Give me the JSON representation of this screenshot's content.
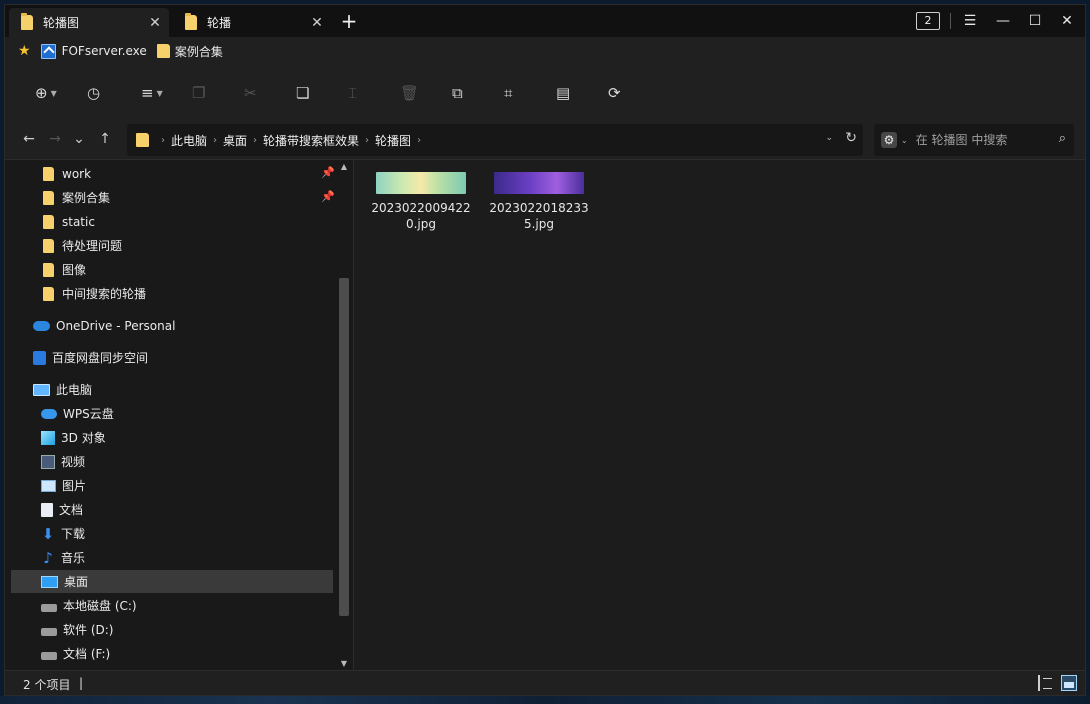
{
  "tabs": [
    {
      "label": "轮播图",
      "close": "✕"
    },
    {
      "label": "轮播",
      "close": "✕"
    }
  ],
  "titlebar": {
    "new_tab": "+",
    "tab_count": "2",
    "menu": "☰",
    "minimize": "—",
    "maximize": "☐",
    "close": "✕"
  },
  "bookmarks": [
    {
      "label": "FOFserver.exe",
      "icon": "exe-icon"
    },
    {
      "label": "案例合集",
      "icon": "folder-icon"
    }
  ],
  "toolbar": {
    "items": [
      {
        "name": "new-button",
        "icon": "plus-circle-icon",
        "glyph": "⊕",
        "enabled": true
      },
      {
        "name": "recent-button",
        "icon": "clock-icon",
        "glyph": "◷",
        "enabled": true
      },
      {
        "name": "view-menu-button",
        "icon": "list-icon",
        "glyph": "≡",
        "enabled": true
      },
      {
        "name": "copy-button",
        "icon": "copy-icon",
        "glyph": "❐",
        "enabled": false
      },
      {
        "name": "cut-button",
        "icon": "scissors-icon",
        "glyph": "✂",
        "enabled": false
      },
      {
        "name": "paste-button",
        "icon": "paste-icon",
        "glyph": "❏",
        "enabled": true
      },
      {
        "name": "rename-button",
        "icon": "rename-icon",
        "glyph": "⌶",
        "enabled": false
      },
      {
        "name": "delete-button",
        "icon": "trash-icon",
        "glyph": "🗑",
        "enabled": false
      },
      {
        "name": "new-window-button",
        "icon": "new-window-icon",
        "glyph": "⧉",
        "enabled": true
      },
      {
        "name": "crop-button",
        "icon": "crop-icon",
        "glyph": "⌗",
        "enabled": true
      },
      {
        "name": "properties-button",
        "icon": "properties-icon",
        "glyph": "▤",
        "enabled": true
      },
      {
        "name": "sync-button",
        "icon": "sync-icon",
        "glyph": "⟳",
        "enabled": true
      }
    ]
  },
  "nav": {
    "back": "←",
    "forward": "→",
    "recent": "⌄",
    "up": "↑"
  },
  "address": {
    "crumbs": [
      "此电脑",
      "桌面",
      "轮播带搜索框效果",
      "轮播图"
    ],
    "separator": "›",
    "dropdown": "⌄",
    "refresh": "↻"
  },
  "search": {
    "placeholder": "在 轮播图 中搜索",
    "gear": "⚙",
    "chevron": "⌄",
    "icon": "⌕"
  },
  "sidebar": {
    "quick_access": [
      {
        "label": "work",
        "pinned": true
      },
      {
        "label": "案例合集",
        "pinned": true
      },
      {
        "label": "static",
        "pinned": false
      },
      {
        "label": "待处理问题",
        "pinned": false
      },
      {
        "label": "图像",
        "pinned": false
      },
      {
        "label": "中间搜索的轮播",
        "pinned": false
      }
    ],
    "onedrive": "OneDrive - Personal",
    "baidu": "百度网盘同步空间",
    "this_pc": "此电脑",
    "pc_items": [
      {
        "label": "WPS云盘",
        "icon": "wps-cloud-icon"
      },
      {
        "label": "3D 对象",
        "icon": "3d-objects-icon"
      },
      {
        "label": "视频",
        "icon": "video-icon"
      },
      {
        "label": "图片",
        "icon": "pictures-icon"
      },
      {
        "label": "文档",
        "icon": "documents-icon"
      },
      {
        "label": "下载",
        "icon": "download-icon"
      },
      {
        "label": "音乐",
        "icon": "music-icon"
      },
      {
        "label": "桌面",
        "icon": "desktop-icon",
        "selected": true
      },
      {
        "label": "本地磁盘 (C:)",
        "icon": "drive-icon"
      },
      {
        "label": "软件 (D:)",
        "icon": "drive-icon"
      },
      {
        "label": "文档 (F:)",
        "icon": "drive-icon"
      }
    ],
    "pin_glyph": "📌"
  },
  "files": [
    {
      "name": "20230220094220.jpg",
      "thumb": "spring"
    },
    {
      "name": "20230220182335.jpg",
      "thumb": "purple"
    }
  ],
  "status": {
    "count_text": "2 个项目",
    "caret": "|"
  }
}
